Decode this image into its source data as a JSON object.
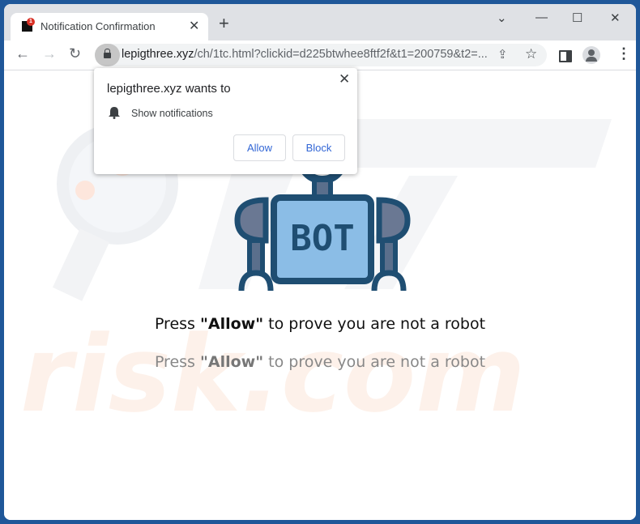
{
  "browser": {
    "tab": {
      "title": "Notification Confirmation",
      "badge": "1"
    },
    "new_tab_label": "+",
    "url_host": "lepigthree.xyz",
    "url_rest": "/ch/1tc.html?clickid=d225btwhee8ftf2f&t1=200759&t2=...",
    "window_controls": {
      "dropdown": "⌄",
      "minimize": "—",
      "maximize": "☐",
      "close": "✕"
    }
  },
  "popup": {
    "title": "lepigthree.xyz wants to",
    "permission": "Show notifications",
    "allow_label": "Allow",
    "block_label": "Block",
    "close_glyph": "✕"
  },
  "page": {
    "bot_label": "BOT",
    "line1_pre": "Press ",
    "line1_bold": "\"Allow\"",
    "line1_post": " to prove you are not a robot",
    "line2_pre": "Press ",
    "line2_bold": "\"Allow\"",
    "line2_post": " to prove you are not a robot"
  },
  "colors": {
    "frame": "#1f5799",
    "button_text": "#3367d6",
    "bot_dark": "#1f4e72",
    "bot_light": "#8bbde6"
  }
}
